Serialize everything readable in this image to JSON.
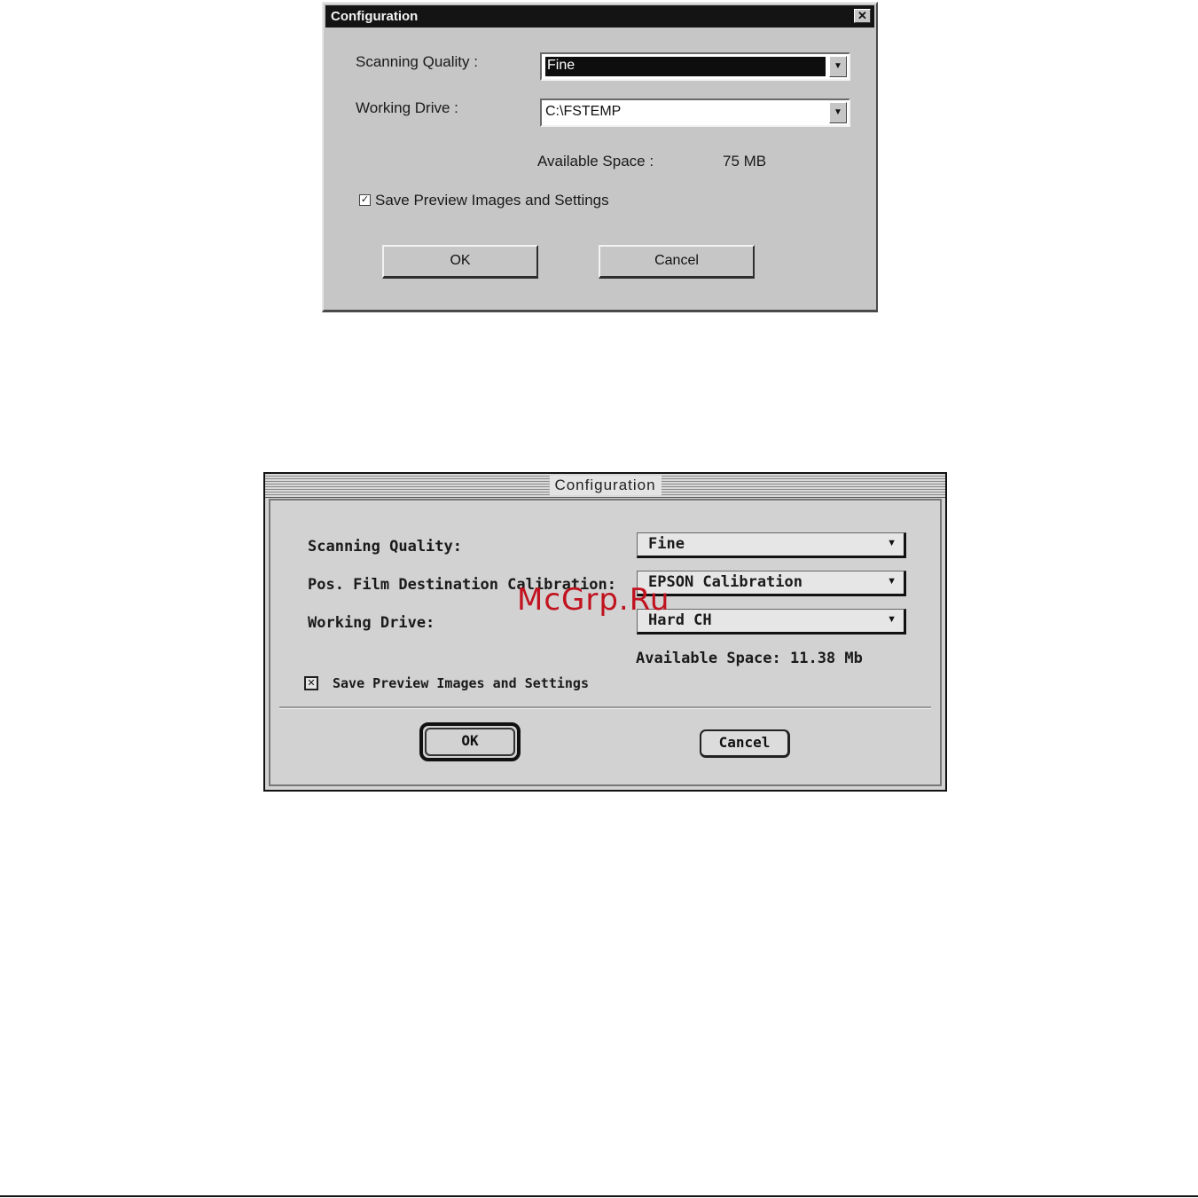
{
  "windows_dialog": {
    "title": "Configuration",
    "close_glyph": "✕",
    "scanning_quality_label": "Scanning Quality :",
    "scanning_quality_value": "Fine",
    "working_drive_label": "Working Drive :",
    "working_drive_value": "C:\\FSTEMP",
    "available_space_label": "Available Space :",
    "available_space_value": "75 MB",
    "save_preview_label": "Save Preview Images and Settings",
    "save_preview_checked": true,
    "ok_label": "OK",
    "cancel_label": "Cancel"
  },
  "mac_dialog": {
    "title": "Configuration",
    "scanning_quality_label": "Scanning Quality:",
    "scanning_quality_value": "Fine",
    "calibration_label": "Pos. Film Destination Calibration:",
    "calibration_value": "EPSON Calibration",
    "working_drive_label": "Working Drive:",
    "working_drive_value": "Hard CH",
    "available_space": "Available Space: 11.38 Mb",
    "save_preview_label": "Save Preview Images and Settings",
    "save_preview_checked": true,
    "ok_label": "OK",
    "cancel_label": "Cancel"
  },
  "watermark": "McGrp.Ru",
  "glyphs": {
    "arrow_down": "▼",
    "check_mark": "✓",
    "mac_check_mark": "✕"
  }
}
